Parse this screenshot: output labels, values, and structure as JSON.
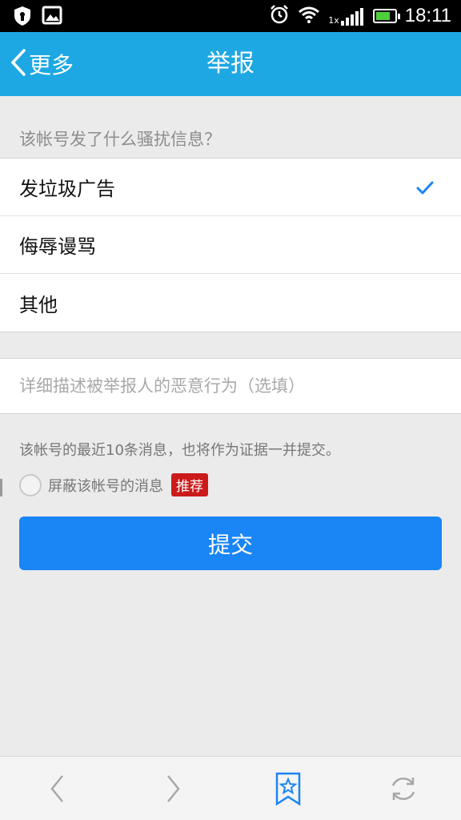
{
  "status_bar": {
    "time": "18:11",
    "icons": [
      "shield-icon",
      "image-icon",
      "alarm-icon",
      "wifi-icon",
      "signal-icon",
      "battery-icon"
    ],
    "signal_text": "1x",
    "battery_level": 0.8,
    "battery_color": "#4cd038"
  },
  "nav": {
    "back_label": "更多",
    "title": "举报",
    "color": "#1ea8e3"
  },
  "question": "该帐号发了什么骚扰信息？",
  "options": [
    {
      "label": "发垃圾广告",
      "selected": true
    },
    {
      "label": "侮辱谩骂",
      "selected": false
    },
    {
      "label": "其他",
      "selected": false
    }
  ],
  "description": {
    "placeholder": "详细描述被举报人的恶意行为（选填）",
    "value": ""
  },
  "evidence_note": "该帐号的最近10条消息，也将作为证据一并提交。",
  "block_option": {
    "label": "屏蔽该帐号的消息",
    "badge": "推荐",
    "checked": false
  },
  "submit": {
    "label": "提交",
    "color": "#1a85f5"
  },
  "bottom_bar": {
    "icons": [
      "back-arrow-icon",
      "forward-arrow-icon",
      "bookmark-star-icon",
      "refresh-icon"
    ]
  }
}
